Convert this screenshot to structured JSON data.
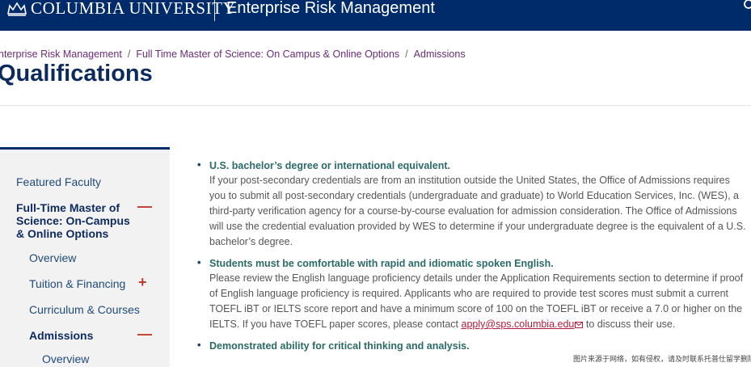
{
  "header": {
    "brand": "COLUMBIA UNIVERSITY",
    "site_title": "Enterprise Risk Management",
    "icons": {
      "logo": "crown-icon",
      "search": "search-icon"
    }
  },
  "breadcrumb": {
    "items": [
      "nterprise Risk Management",
      "Full Time Master of Science: On Campus & Online Options",
      "Admissions"
    ],
    "separator": "/"
  },
  "page": {
    "title": "Qualifications"
  },
  "sidebar": {
    "items": [
      {
        "label": "Featured Faculty"
      },
      {
        "label": "Full-Time Master of Science: On-Campus & Online Options",
        "toggle": "—"
      },
      {
        "label": "Overview"
      },
      {
        "label": "Tuition & Financing",
        "toggle": "+"
      },
      {
        "label": "Curriculum & Courses"
      },
      {
        "label": "Admissions",
        "toggle": "—"
      },
      {
        "label": "Overview"
      }
    ]
  },
  "requirements": [
    {
      "heading": "U.S. bachelor’s degree or international equivalent.",
      "body": "If your post-secondary credentials are from an institution outside the United States, the Office of Admissions requires you to submit all post-secondary credentials (undergraduate and graduate) to World Education Services, Inc. (WES), a third-party verification agency for a course-by-course evaluation for admission consideration. The Office of Admissions will use the credential evaluation provided by WES to determine if your undergraduate degree is the equivalent of a U.S. bachelor’s degree."
    },
    {
      "heading": "Students must be comfortable with rapid and idiomatic spoken English.",
      "body_before_link": "Please review the English language proficiency details under the Application Requirements section to determine if proof of English language proficiency is required. Applicants who are required to provide test scores must submit a current TOEFL iBT or IELTS score report and have a minimum score of 100 on the TOEFL iBT or receive a 7.0 or higher on the IELTS. If you have TOEFL paper scores, please contact ",
      "link": "apply@sps.columbia.edu",
      "body_after_link": " to discuss their use."
    },
    {
      "heading": "Demonstrated ability for critical thinking and analysis."
    }
  ],
  "watermark": "图片来源于网络，如有侵权，请及时联系托普仕留学删除",
  "colors": {
    "header_bg": "#002b6a",
    "breadcrumb_link": "#6a2c79",
    "title": "#0d2a5c",
    "requirement_heading": "#2b6a67",
    "link": "#b71c3a",
    "toggle": "#c0392b"
  }
}
